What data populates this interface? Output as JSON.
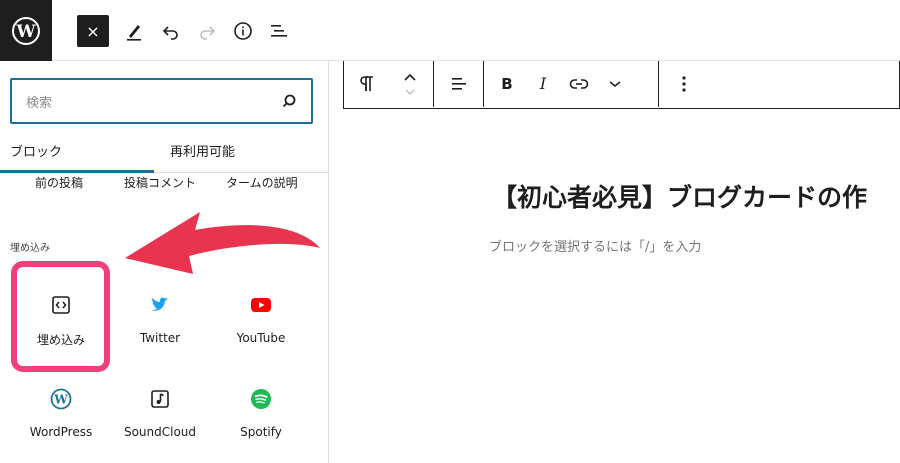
{
  "topbar": {
    "close_label": "×"
  },
  "inserter": {
    "search_placeholder": "検索",
    "tabs": [
      {
        "label": "ブロック"
      },
      {
        "label": "再利用可能"
      }
    ],
    "previous_row": [
      "前の投稿",
      "投稿コメント",
      "タームの説明"
    ],
    "category_heading": "埋め込み",
    "blocks": [
      {
        "label": "埋め込み"
      },
      {
        "label": "Twitter"
      },
      {
        "label": "YouTube"
      },
      {
        "label": "WordPress"
      },
      {
        "label": "SoundCloud"
      },
      {
        "label": "Spotify"
      }
    ]
  },
  "editor": {
    "post_title": "【初心者必見】ブログカードの作",
    "placeholder": "ブロックを選択するには「/」を入力"
  },
  "colors": {
    "accent": "#1d6f99",
    "highlight": "#ef3f7c",
    "twitter": "#1da1f2",
    "youtube": "#ff0000",
    "wordpress": "#21759b",
    "spotify": "#1db954"
  }
}
